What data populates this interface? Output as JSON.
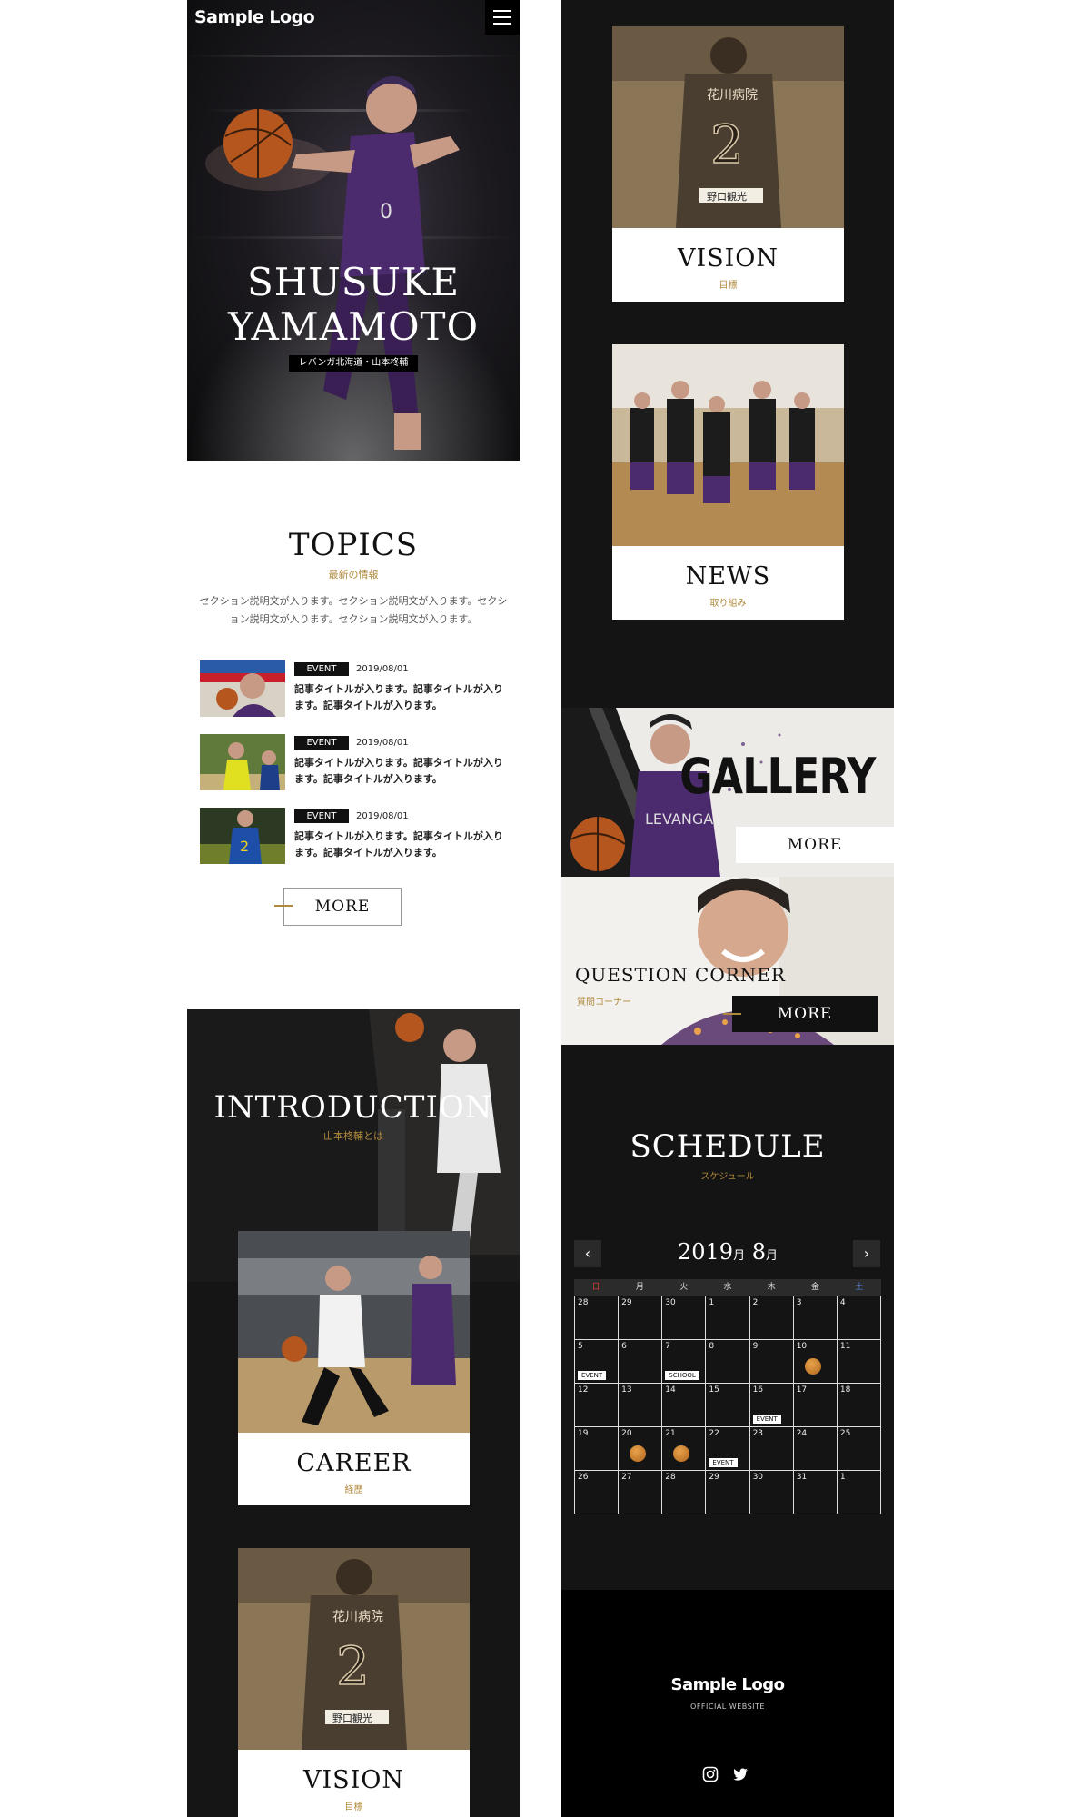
{
  "hero": {
    "logo": "Sample Logo",
    "title_line1": "SHUSUKE",
    "title_line2": "YAMAMOTO",
    "subtitle": "レバンガ北海道・山本柊輔"
  },
  "topics": {
    "title": "TOPICS",
    "subtitle": "最新の情報",
    "description": "セクション説明文が入ります。セクション説明文が入ります。セクション説明文が入ります。セクション説明文が入ります。",
    "items": [
      {
        "tag": "EVENT",
        "date": "2019/08/01",
        "title": "記事タイトルが入ります。記事タイトルが入ります。記事タイトルが入ります。"
      },
      {
        "tag": "EVENT",
        "date": "2019/08/01",
        "title": "記事タイトルが入ります。記事タイトルが入ります。記事タイトルが入ります。"
      },
      {
        "tag": "EVENT",
        "date": "2019/08/01",
        "title": "記事タイトルが入ります。記事タイトルが入ります。記事タイトルが入ります。"
      }
    ],
    "more": "MORE"
  },
  "introduction": {
    "title": "INTRODUCTION",
    "subtitle": "山本柊輔とは",
    "career_title": "CAREER",
    "career_sub": "経歴",
    "vision_title": "VISION",
    "vision_sub": "目標"
  },
  "right_cards": {
    "vision_title": "VISION",
    "vision_sub": "目標",
    "news_title": "NEWS",
    "news_sub": "取り組み"
  },
  "gallery": {
    "title": "GALLERY",
    "more": "MORE"
  },
  "question": {
    "title": "QUESTION CORNER",
    "subtitle": "質問コーナー",
    "more": "MORE"
  },
  "schedule": {
    "title": "SCHEDULE",
    "subtitle": "スケジュール",
    "year": "2019",
    "year_unit": "月",
    "month": "8",
    "month_unit": "月",
    "weekdays": [
      "日",
      "月",
      "火",
      "水",
      "木",
      "金",
      "土"
    ],
    "days": [
      {
        "n": "28"
      },
      {
        "n": "29"
      },
      {
        "n": "30"
      },
      {
        "n": "1"
      },
      {
        "n": "2"
      },
      {
        "n": "3"
      },
      {
        "n": "4"
      },
      {
        "n": "5",
        "label": "EVENT"
      },
      {
        "n": "6"
      },
      {
        "n": "7",
        "label": "SCHOOL"
      },
      {
        "n": "8"
      },
      {
        "n": "9"
      },
      {
        "n": "10",
        "ball": true
      },
      {
        "n": "11"
      },
      {
        "n": "12"
      },
      {
        "n": "13"
      },
      {
        "n": "14"
      },
      {
        "n": "15"
      },
      {
        "n": "16",
        "label": "EVENT"
      },
      {
        "n": "17"
      },
      {
        "n": "18"
      },
      {
        "n": "19"
      },
      {
        "n": "20",
        "ball": true
      },
      {
        "n": "21",
        "ball": true
      },
      {
        "n": "22",
        "label": "EVENT"
      },
      {
        "n": "23"
      },
      {
        "n": "24"
      },
      {
        "n": "25"
      },
      {
        "n": "26"
      },
      {
        "n": "27"
      },
      {
        "n": "28"
      },
      {
        "n": "29"
      },
      {
        "n": "30"
      },
      {
        "n": "31"
      },
      {
        "n": "1"
      }
    ],
    "prev_icon": "chevron-left-icon",
    "next_icon": "chevron-right-icon",
    "sunday_color": "#e0403a",
    "saturday_color": "#4a7de0"
  },
  "footer": {
    "logo": "Sample Logo",
    "sub": "OFFICIAL WEBSITE",
    "icons": [
      "instagram-icon",
      "twitter-icon"
    ]
  },
  "colors": {
    "accent": "#b08a3c",
    "dark": "#141414",
    "purple": "#4b2a6e"
  }
}
